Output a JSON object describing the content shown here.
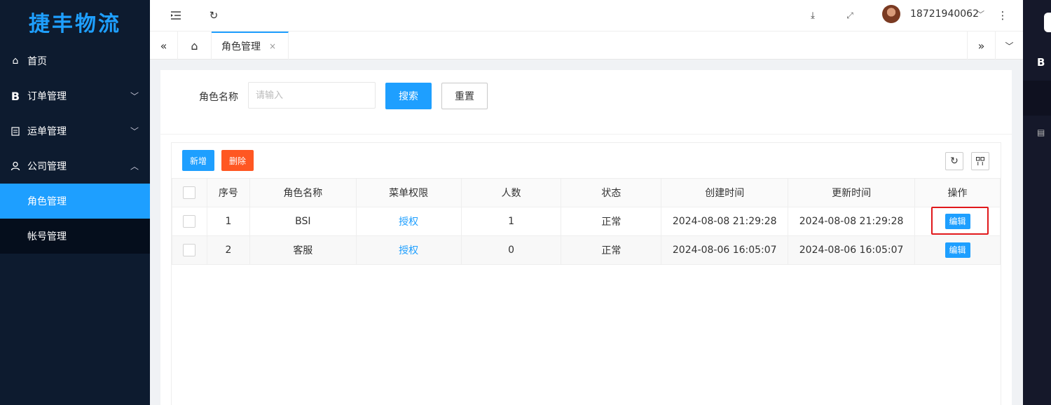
{
  "app": {
    "logo": "捷丰物流"
  },
  "sidebar": {
    "items": [
      {
        "label": "首页",
        "icon": "home-icon"
      },
      {
        "label": "订单管理",
        "icon": "b-icon"
      },
      {
        "label": "运单管理",
        "icon": "clipboard-icon"
      },
      {
        "label": "公司管理",
        "icon": "user-icon"
      }
    ],
    "submenu": [
      {
        "label": "角色管理",
        "active": true
      },
      {
        "label": "帐号管理",
        "active": false
      }
    ]
  },
  "header": {
    "username": "18721940062"
  },
  "tabs": [
    {
      "label": "角色管理",
      "close": "×"
    }
  ],
  "search": {
    "label": "角色名称",
    "placeholder": "请输入",
    "search_btn": "搜索",
    "reset_btn": "重置"
  },
  "toolbar": {
    "add_btn": "新增",
    "delete_btn": "删除"
  },
  "table": {
    "columns": [
      "序号",
      "角色名称",
      "菜单权限",
      "人数",
      "状态",
      "创建时间",
      "更新时间",
      "操作"
    ],
    "rows": [
      {
        "index": "1",
        "name": "BSI",
        "perm": "授权",
        "count": "1",
        "status": "正常",
        "created": "2024-08-08 21:29:28",
        "updated": "2024-08-08 21:29:28",
        "action": "编辑"
      },
      {
        "index": "2",
        "name": "客服",
        "perm": "授权",
        "count": "0",
        "status": "正常",
        "created": "2024-08-06 16:05:07",
        "updated": "2024-08-06 16:05:07",
        "action": "编辑"
      }
    ]
  },
  "rightpanel": {
    "letter": "B"
  },
  "colors": {
    "primary": "#1e9fff",
    "danger": "#ff5722",
    "sidebar_bg": "#0d1b2f",
    "highlight": "#e0181b"
  }
}
